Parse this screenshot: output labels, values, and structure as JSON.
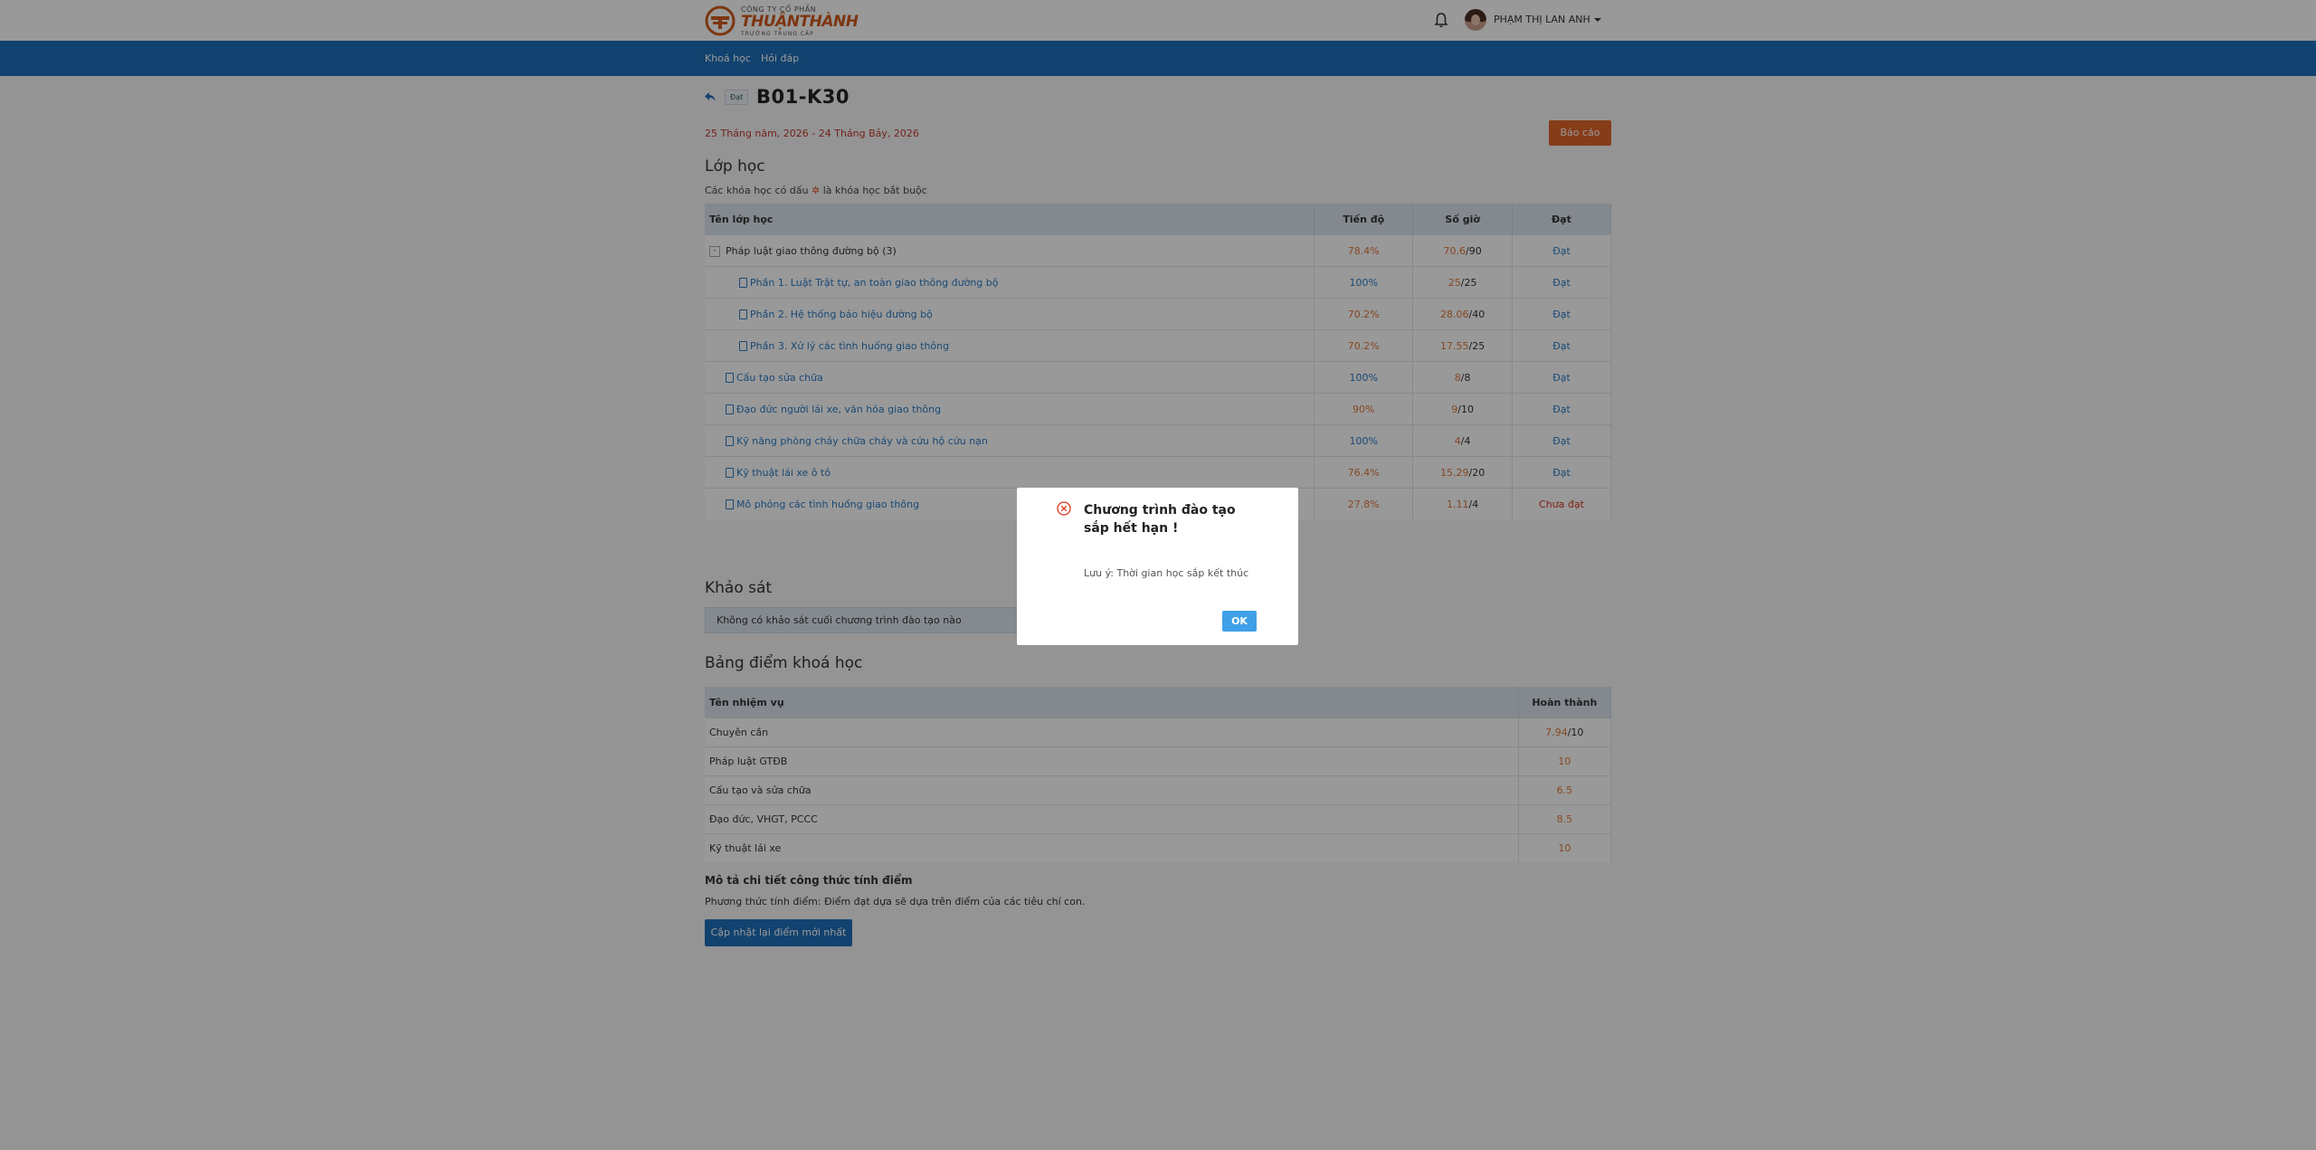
{
  "header": {
    "logo": {
      "line1": "CÔNG TY CỔ PHẦN",
      "line2": "THUẬNTHÀNH",
      "line3": "TRƯỜNG TRUNG CẤP"
    },
    "username": "PHẠM THỊ LAN ANH"
  },
  "nav": {
    "items": [
      "Khoá học",
      "Hỏi đáp"
    ]
  },
  "course": {
    "status_badge": "Đạt",
    "code": "B01-K30",
    "date_range": "25 Tháng năm, 2026 - 24 Tháng Bảy, 2026",
    "report_button": "Báo cáo"
  },
  "classes": {
    "title": "Lớp học",
    "note_prefix": "Các khóa học có dấu",
    "note_star": "✲",
    "note_suffix": "là khóa học bắt buộc",
    "headers": [
      "Tên lớp học",
      "Tiến độ",
      "Số giờ",
      "Đạt"
    ],
    "rows": [
      {
        "name": "Pháp luật giao thông đường bộ",
        "count": "(3)",
        "progress": "78.4%",
        "hours_done": "70.6",
        "hours_total": "/90",
        "status": "Đạt"
      },
      {
        "name": "Phần 1. Luật Trật tự, an toàn giao thông đường bộ",
        "progress": "100%",
        "hours_done": "25",
        "hours_total": "/25",
        "status": "Đạt"
      },
      {
        "name": "Phần 2. Hệ thống báo hiệu đường bộ",
        "progress": "70.2%",
        "hours_done": "28.06",
        "hours_total": "/40",
        "status": "Đạt"
      },
      {
        "name": "Phần 3. Xử lý các tình huống giao thông",
        "progress": "70.2%",
        "hours_done": "17.55",
        "hours_total": "/25",
        "status": "Đạt"
      },
      {
        "name": "Cấu tạo sửa chữa",
        "progress": "100%",
        "hours_done": "8",
        "hours_total": "/8",
        "status": "Đạt"
      },
      {
        "name": "Đạo đức người lái xe, văn hóa giao thông",
        "progress": "90%",
        "hours_done": "9",
        "hours_total": "/10",
        "status": "Đạt"
      },
      {
        "name": "Kỹ năng phòng cháy chữa cháy và cứu hộ cứu nạn",
        "progress": "100%",
        "hours_done": "4",
        "hours_total": "/4",
        "status": "Đạt"
      },
      {
        "name": "Kỹ thuật lái xe ô tô",
        "progress": "76.4%",
        "hours_done": "15.29",
        "hours_total": "/20",
        "status": "Đạt"
      },
      {
        "name": "Mô phỏng các tình huống giao thông",
        "progress": "27.8%",
        "hours_done": "1.11",
        "hours_total": "/4",
        "status": "Chưa đạt"
      }
    ]
  },
  "survey": {
    "title": "Khảo sát",
    "message": "Không có khảo sát cuối chương trình đào tạo nào"
  },
  "scores": {
    "title": "Bảng điểm khoá học",
    "headers": [
      "Tên nhiệm vụ",
      "Hoàn thành"
    ],
    "rows": [
      {
        "name": "Chuyên cần",
        "value": "7.94",
        "suffix": "/10"
      },
      {
        "name": "Pháp luật GTĐB",
        "value": "10",
        "suffix": ""
      },
      {
        "name": "Cấu tạo và sửa chữa",
        "value": "6.5",
        "suffix": ""
      },
      {
        "name": "Đạo đức, VHGT, PCCC",
        "value": "8.5",
        "suffix": ""
      },
      {
        "name": "Kỹ thuật lái xe",
        "value": "10",
        "suffix": ""
      }
    ],
    "formula_title": "Mô tả chi tiết công thức tính điểm",
    "formula_text": "Phương thức tính điểm: Điểm đạt dựa sẽ dựa trên điểm của các tiêu chí con.",
    "update_button": "Cập nhật lại điểm mới nhất"
  },
  "modal": {
    "title": "Chương trình đào tạo sắp hết hạn !",
    "message": "Lưu ý: Thời gian học sắp kết thúc",
    "ok_button": "OK"
  },
  "colors": {
    "nav_blue": "#1e6fb9",
    "accent_orange": "#e2642a",
    "progress_orange": "#e0773b",
    "link_blue": "#2b7bc4",
    "fail_red": "#d9331e",
    "ok_blue": "#3fa0e8"
  }
}
